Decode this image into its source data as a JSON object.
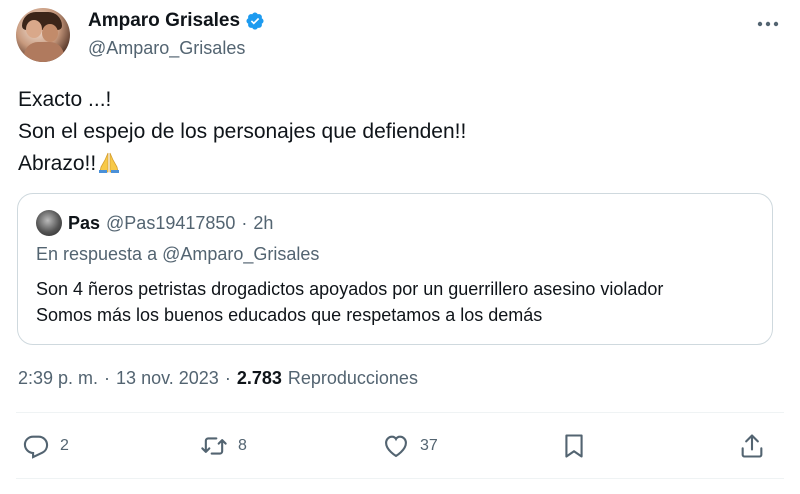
{
  "author": {
    "name": "Amparo Grisales",
    "handle": "@Amparo_Grisales"
  },
  "tweet": {
    "lines": [
      "Exacto ...!",
      "Son el espejo de los personajes que defienden!!",
      "Abrazo!!"
    ],
    "emoji": "folded-hands"
  },
  "quote": {
    "name": "Pas",
    "handle": "@Pas19417850",
    "separator": "·",
    "time": "2h",
    "reply_to": "En respuesta a @Amparo_Grisales",
    "lines": [
      "Son 4 ñeros petristas drogadictos apoyados por un guerrillero asesino violador",
      "Somos más los buenos educados que respetamos a los demás"
    ]
  },
  "meta": {
    "time": "2:39 p. m.",
    "sep1": "·",
    "date": "13 nov. 2023",
    "sep2": "·",
    "views": "2.783",
    "views_label": "Reproducciones"
  },
  "actions": {
    "replies": "2",
    "retweets": "8",
    "likes": "37"
  },
  "colors": {
    "verified": "#1d9bf0",
    "secondary_text": "#536471",
    "border": "#cfd9de"
  }
}
